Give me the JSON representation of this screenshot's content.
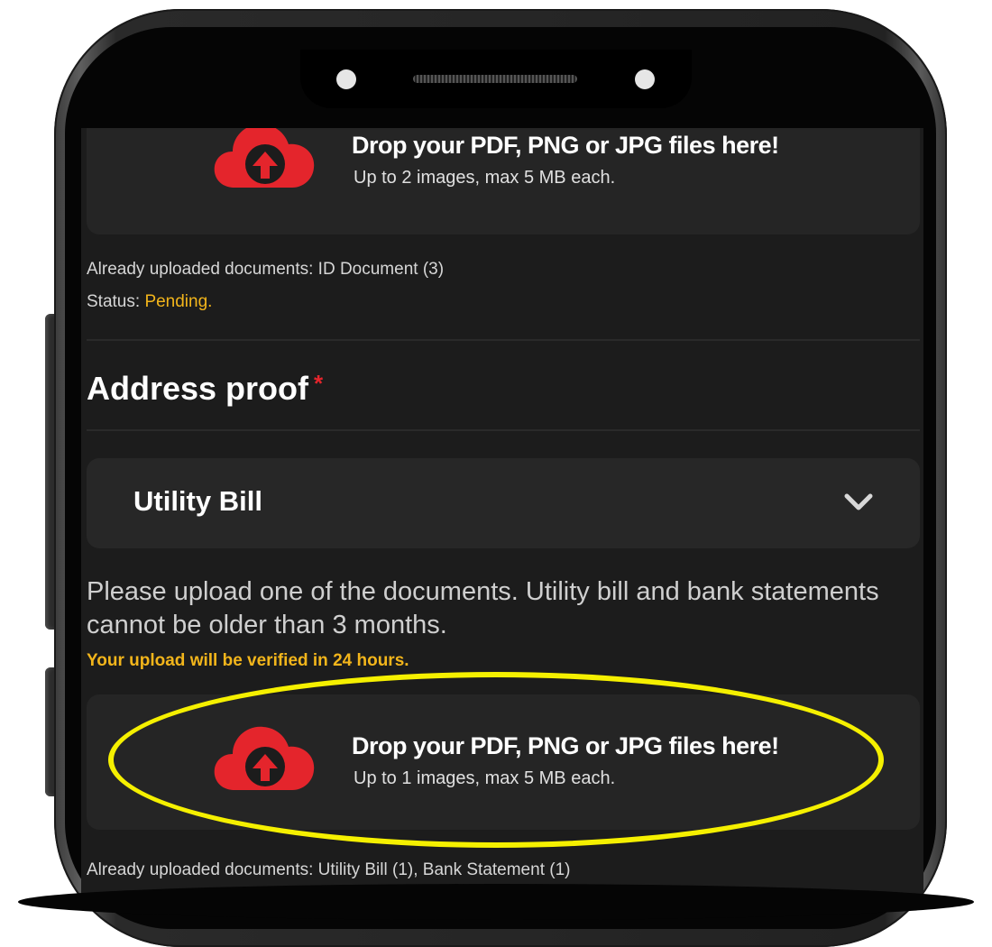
{
  "upload_1": {
    "title": "Drop your PDF, PNG or JPG files here!",
    "subtitle": "Up to 2 images, max 5 MB each."
  },
  "id_section": {
    "uploaded_text": "Already uploaded documents: ID Document (3)",
    "status_label": "Status:",
    "status_value": "Pending."
  },
  "address_proof": {
    "title": "Address proof",
    "required_marker": "*",
    "document_type_selected": "Utility Bill",
    "instructions": "Please upload one of the documents. Utility bill and bank statements cannot be older than 3 months.",
    "verify_note": "Your upload will be verified in 24 hours."
  },
  "upload_2": {
    "title": "Drop your PDF, PNG or JPG files here!",
    "subtitle": "Up to 1 images, max 5 MB each."
  },
  "address_uploaded_text": "Already uploaded documents: Utility Bill (1), Bank Statement (1)",
  "colors": {
    "accent_red": "#e4252c",
    "status_yellow": "#f2b51b",
    "highlight_yellow": "#f5f000",
    "screen_bg": "#1c1c1c"
  },
  "icons": [
    "cloud-upload-icon",
    "chevron-down-icon",
    "front-camera-icon",
    "speaker-grille-icon"
  ]
}
